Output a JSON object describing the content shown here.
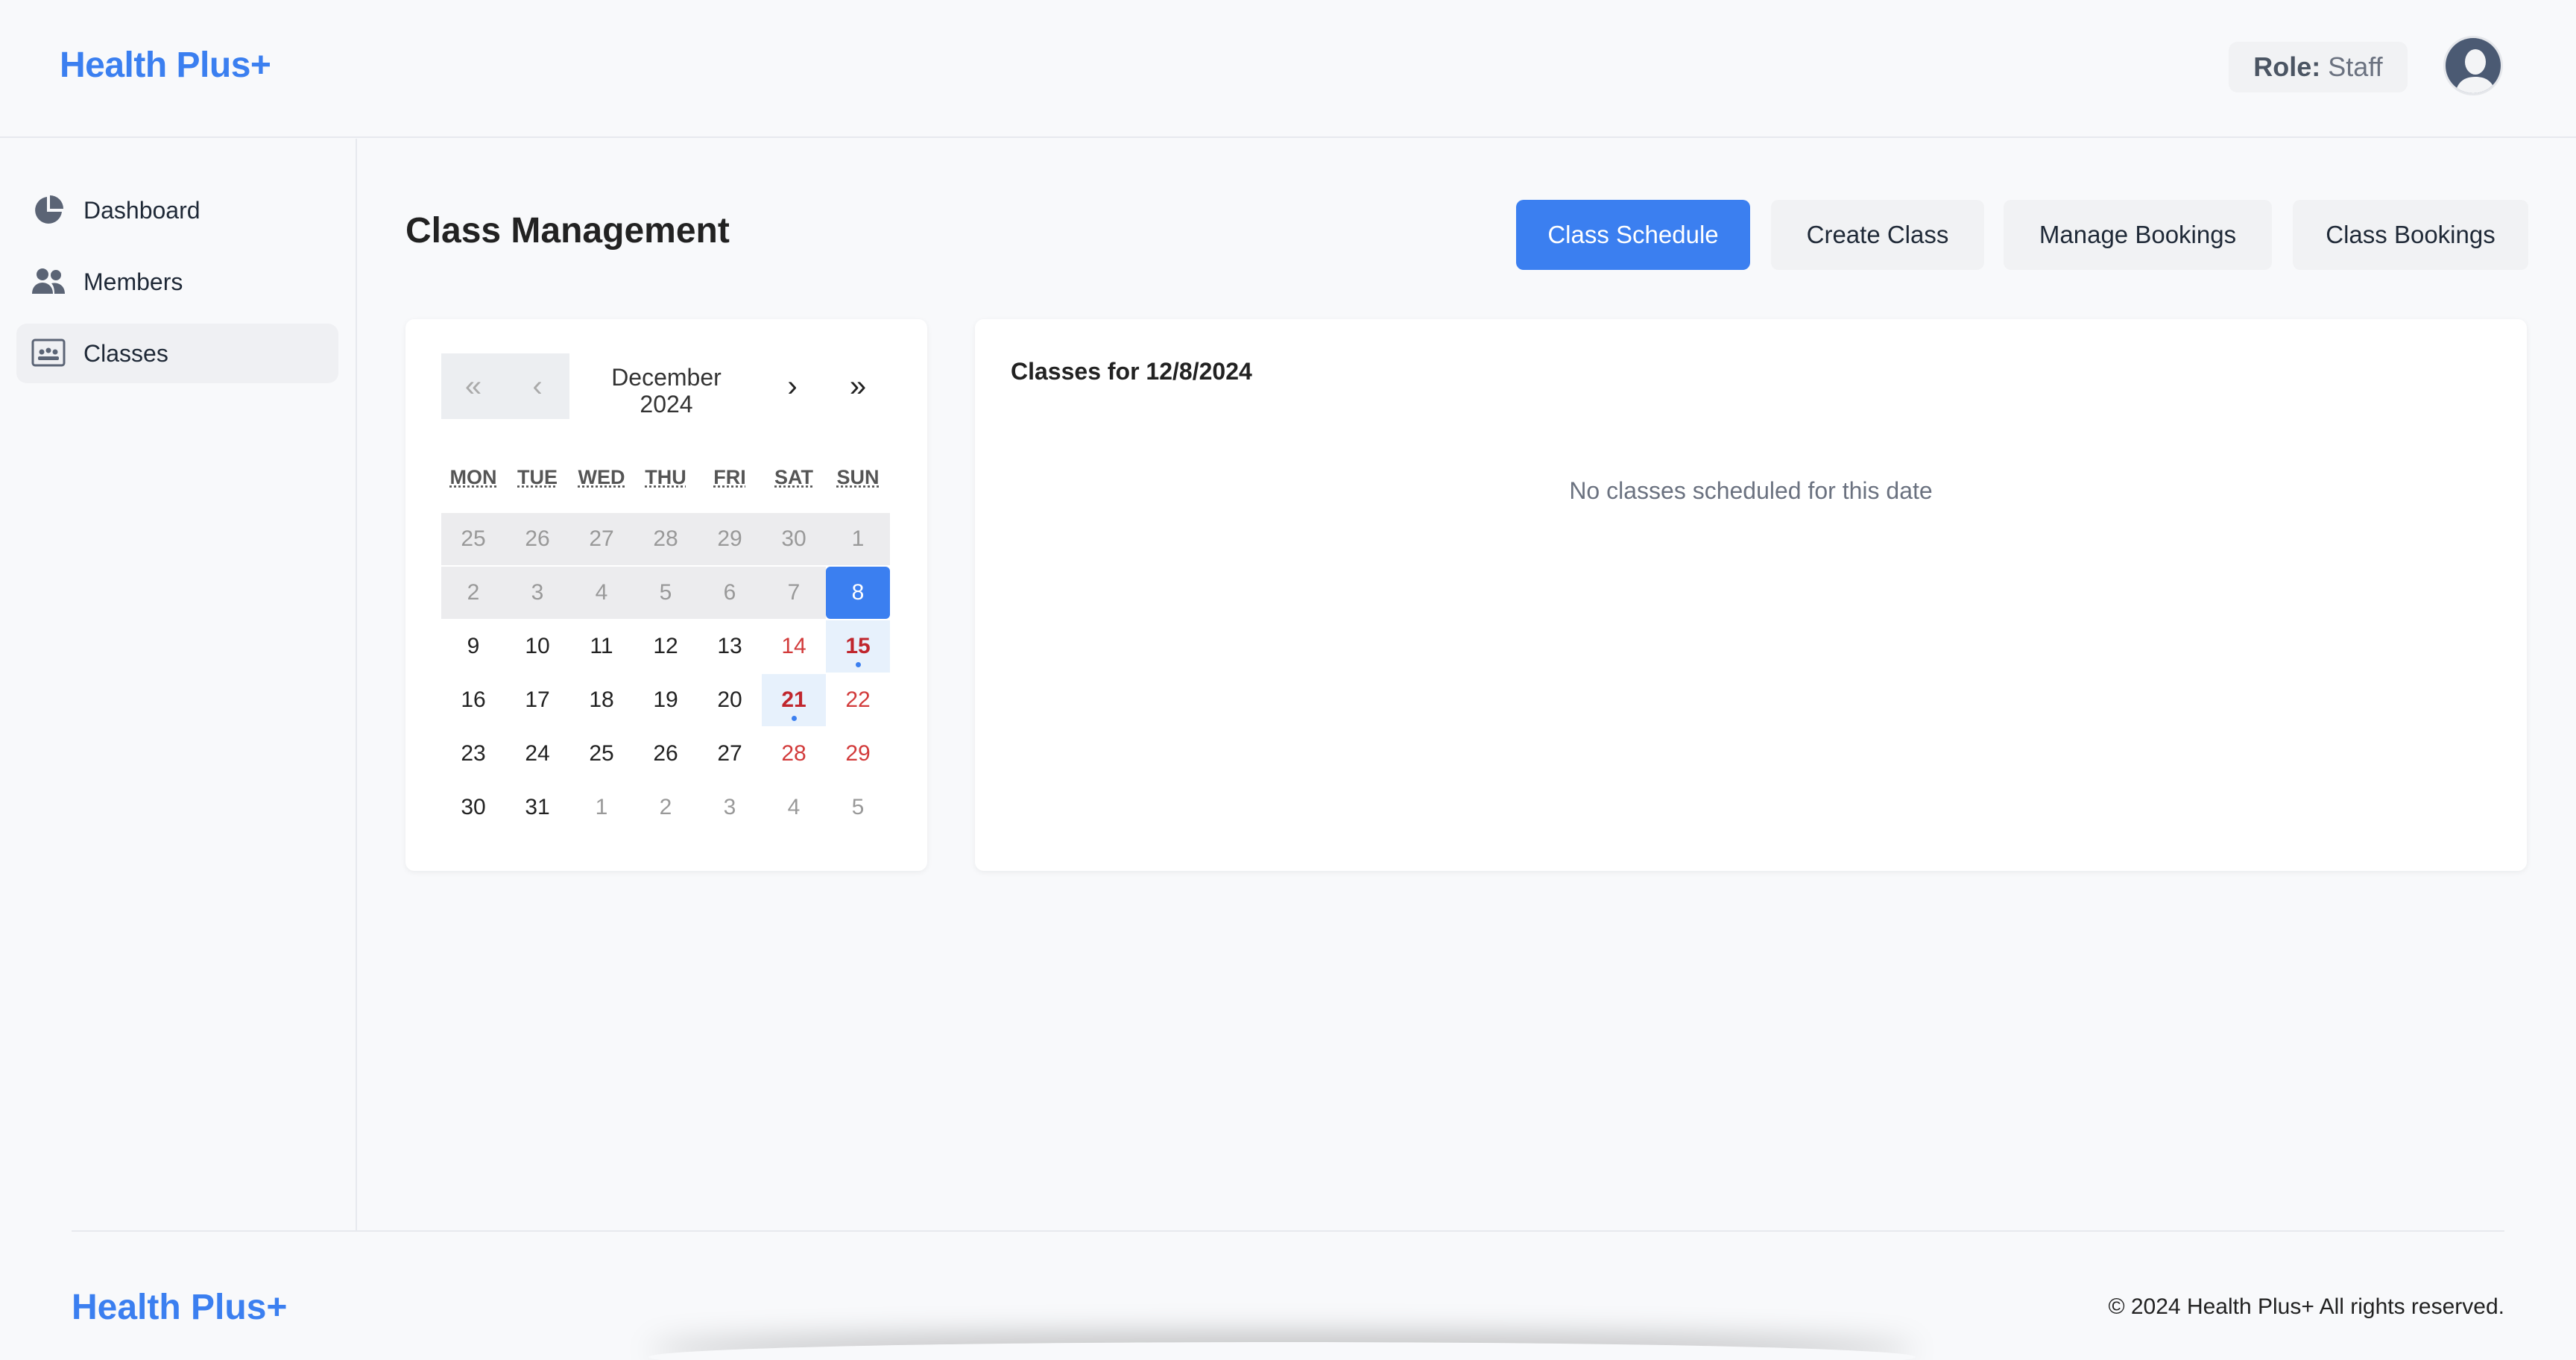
{
  "header": {
    "brand": "Health Plus+",
    "role_label": "Role:",
    "role_value": "Staff"
  },
  "sidebar": {
    "items": [
      {
        "label": "Dashboard",
        "icon": "pie-chart-icon"
      },
      {
        "label": "Members",
        "icon": "people-icon"
      },
      {
        "label": "Classes",
        "icon": "classroom-icon",
        "active": true
      }
    ]
  },
  "main": {
    "title": "Class Management",
    "tabs": [
      {
        "label": "Class Schedule",
        "active": true
      },
      {
        "label": "Create Class"
      },
      {
        "label": "Manage Bookings"
      },
      {
        "label": "Class Bookings"
      }
    ]
  },
  "calendar": {
    "prev_year": "«",
    "prev_month": "‹",
    "month": "December",
    "year": "2024",
    "next_month": "›",
    "next_year": "»",
    "weekdays": [
      "MON",
      "TUE",
      "WED",
      "THU",
      "FRI",
      "SAT",
      "SUN"
    ],
    "weeks": [
      [
        "25",
        "26",
        "27",
        "28",
        "29",
        "30",
        "1"
      ],
      [
        "2",
        "3",
        "4",
        "5",
        "6",
        "7",
        "8"
      ],
      [
        "9",
        "10",
        "11",
        "12",
        "13",
        "14",
        "15"
      ],
      [
        "16",
        "17",
        "18",
        "19",
        "20",
        "21",
        "22"
      ],
      [
        "23",
        "24",
        "25",
        "26",
        "27",
        "28",
        "29"
      ],
      [
        "30",
        "31",
        "1",
        "2",
        "3",
        "4",
        "5"
      ]
    ],
    "selected_date": "8",
    "days_with_classes": [
      "15",
      "21"
    ],
    "colors": {
      "accent": "#3b7ff0",
      "weekend": "#d23b3b",
      "class_day_bg": "#e7f1fc"
    }
  },
  "classes_panel": {
    "title": "Classes for 12/8/2024",
    "empty_message": "No classes scheduled for this date"
  },
  "footer": {
    "brand": "Health Plus+",
    "copyright": "© 2024 Health Plus+ All rights reserved."
  }
}
